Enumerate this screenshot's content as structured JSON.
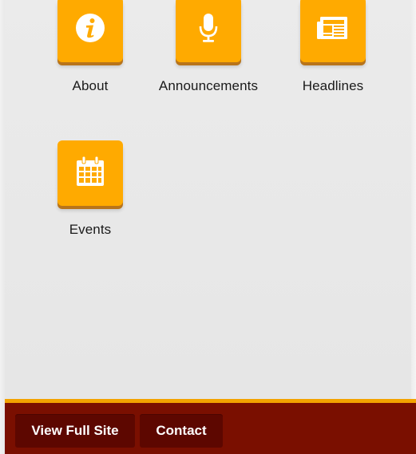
{
  "tiles": [
    {
      "label": "About",
      "icon": "info-icon"
    },
    {
      "label": "Announcements",
      "icon": "microphone-icon"
    },
    {
      "label": "Headlines",
      "icon": "newspaper-icon"
    },
    {
      "label": "Events",
      "icon": "calendar-icon"
    }
  ],
  "footer": {
    "full_site_label": "View Full Site",
    "contact_label": "Contact"
  },
  "colors": {
    "tile_orange": "#ffaa00",
    "footer_maroon": "#7a0f00",
    "footer_accent": "#f3a300",
    "button_dark": "#5d0700"
  }
}
